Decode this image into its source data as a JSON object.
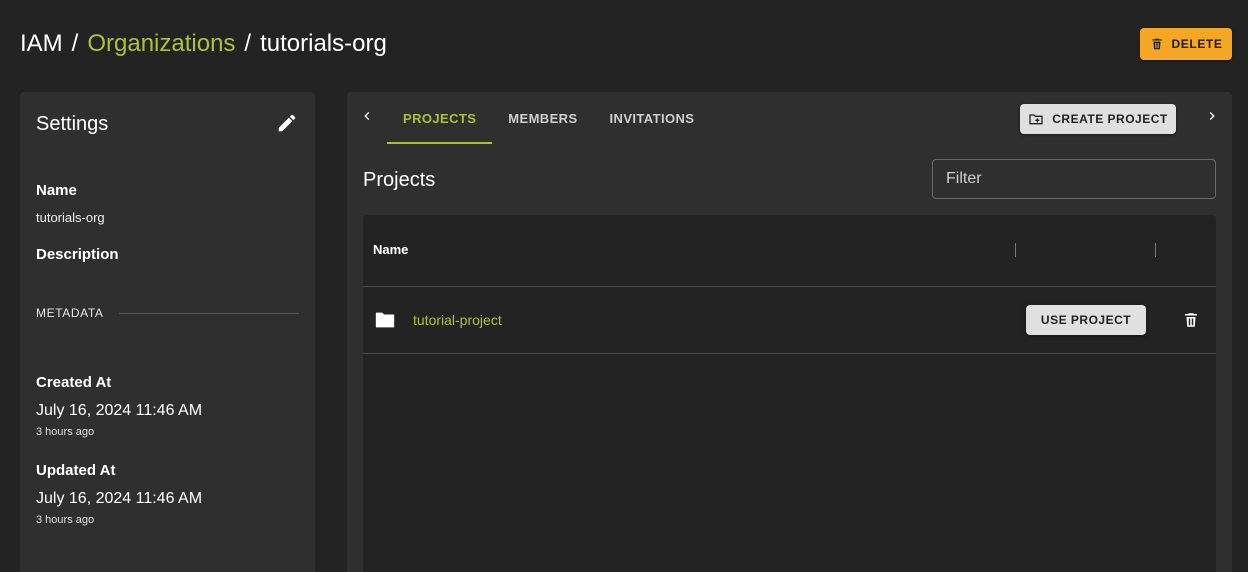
{
  "breadcrumb": {
    "root": "IAM",
    "separator": "/",
    "organizations": "Organizations",
    "current": "tutorials-org"
  },
  "header": {
    "delete_label": "DELETE"
  },
  "settings": {
    "title": "Settings",
    "name_label": "Name",
    "name_value": "tutorials-org",
    "description_label": "Description",
    "metadata_label": "METADATA",
    "created_label": "Created At",
    "created_date": "July 16, 2024 11:46 AM",
    "created_ago": "3 hours ago",
    "updated_label": "Updated At",
    "updated_date": "July 16, 2024 11:46 AM",
    "updated_ago": "3 hours ago"
  },
  "tabs": [
    {
      "label": "PROJECTS",
      "active": true
    },
    {
      "label": "MEMBERS",
      "active": false
    },
    {
      "label": "INVITATIONS",
      "active": false
    }
  ],
  "toolbar": {
    "create_project_label": "CREATE PROJECT"
  },
  "projects": {
    "title": "Projects",
    "filter_placeholder": "Filter",
    "columns": [
      "Name"
    ],
    "rows": [
      {
        "name": "tutorial-project",
        "action_label": "USE PROJECT"
      }
    ]
  },
  "colors": {
    "accent": "#a9c23a",
    "danger_button": "#f5a623",
    "background": "#232323",
    "panel": "#2f2f2f"
  },
  "icons": {
    "delete": "trash-icon",
    "edit": "pencil-icon",
    "create_project": "folder-plus-icon",
    "project": "folder-icon",
    "tabs_prev": "chevron-left-icon",
    "tabs_next": "chevron-right-icon"
  }
}
